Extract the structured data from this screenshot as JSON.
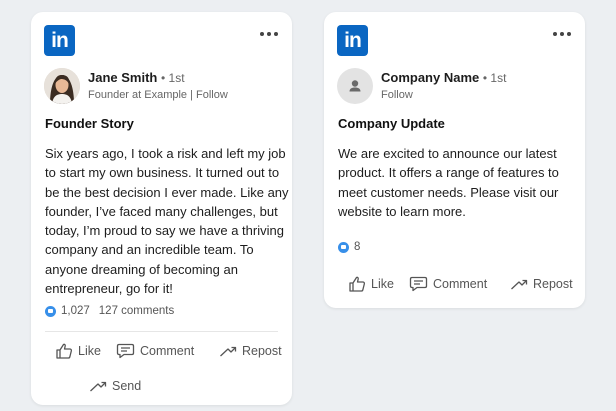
{
  "posts": [
    {
      "logo_text": "in",
      "author": {
        "name": "Jane Smith",
        "degree": "• 1st",
        "subtitle": "Founder at Example | Follow"
      },
      "title": "Founder Story",
      "body": "Six years ago, I took a risk and left my job to start my own business. It turned out to be the best decision I ever made. Like any founder, I’ve faced many challenges, but today, I’m proud to say we have a thriving company and an incredible team. To anyone dreaming of becoming an entrepreneur, go for it!",
      "reactions_count": "1,027",
      "comments_count": "127 comments",
      "actions": {
        "like": "Like",
        "comment": "Comment",
        "repost": "Repost",
        "send": "Send"
      }
    },
    {
      "logo_text": "in",
      "author": {
        "name": "Company Name",
        "degree": "• 1st",
        "subtitle": "Follow"
      },
      "title": "Company Update",
      "body": "We are excited to announce our latest product. It offers a range of features to meet customer needs. Please visit our website to learn more.",
      "reactions_count": "8",
      "actions": {
        "like": "Like",
        "comment": "Comment",
        "repost": "Repost"
      }
    }
  ],
  "colors": {
    "brand": "#0a66c2",
    "like_accent": "#378fe9",
    "background": "#eceff2"
  },
  "icons": [
    "linkedin-logo",
    "more-icon",
    "thumbs-up-icon",
    "comment-icon",
    "repost-icon",
    "send-icon",
    "person-icon"
  ]
}
